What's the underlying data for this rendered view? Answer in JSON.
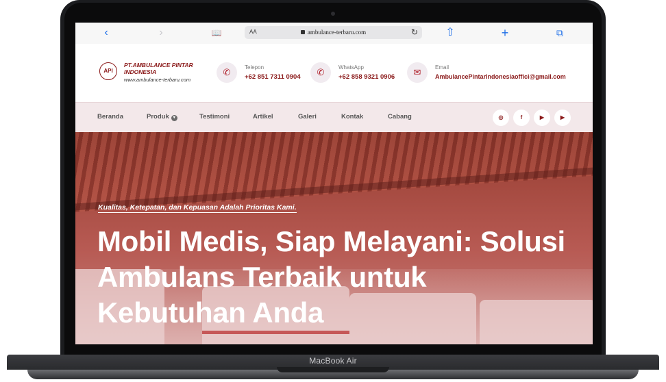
{
  "device": {
    "brand_label": "MacBook Air"
  },
  "browser": {
    "back_glyph": "‹",
    "forward_glyph": "›",
    "reader_glyph": "📖",
    "text_size_label": "AA",
    "url": "ambulance-terbaru.com",
    "reload_glyph": "↻",
    "share_glyph": "⇧",
    "new_tab_glyph": "+",
    "tabs_glyph": "⧉"
  },
  "header": {
    "logo_text": "API",
    "company_name": "PT.AMBULANCE PINTAR INDONESIA",
    "domain": "www.ambulance-terbaru.com",
    "contacts": [
      {
        "icon": "phone-icon",
        "glyph": "✆",
        "label": "Telepon",
        "value": "+62 851 7311 0904"
      },
      {
        "icon": "whatsapp-icon",
        "glyph": "✆",
        "label": "WhatsApp",
        "value": "+62 858 9321 0906"
      },
      {
        "icon": "email-icon",
        "glyph": "✉",
        "label": "Email",
        "value": "AmbulancePintarIndonesiaoffici@gmail.com"
      }
    ]
  },
  "nav": {
    "items": [
      "Beranda",
      "Produk",
      "Testimoni",
      "Artikel",
      "Galeri",
      "Kontak",
      "Cabang"
    ],
    "dropdown_glyph": "▾",
    "social": [
      {
        "icon": "whatsapp-icon",
        "glyph": "◎"
      },
      {
        "icon": "facebook-icon",
        "glyph": "f"
      },
      {
        "icon": "youtube-icon",
        "glyph": "▶"
      },
      {
        "icon": "youtube-icon",
        "glyph": "▶"
      }
    ]
  },
  "hero": {
    "tagline": "Kualitas, Ketepatan, dan Kepuasan Adalah Prioritas Kami.",
    "headline": "Mobil Medis, Siap Melayani: Solusi Ambulans Terbaik untuk Kebutuhan Anda"
  },
  "colors": {
    "brand": "#8b1a1a",
    "accent_blue": "#1e6fe8",
    "nav_bg": "#f3e8ea"
  }
}
